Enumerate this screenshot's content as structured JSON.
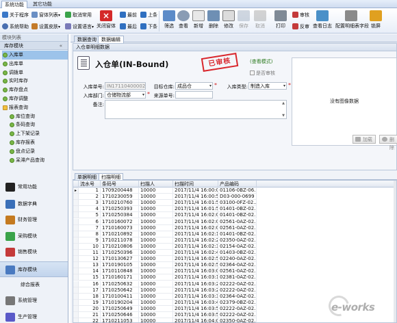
{
  "top_tabs": [
    "系统功能",
    "其它功能"
  ],
  "ribbon": {
    "small": [
      {
        "label": "关于程序",
        "icon": "info-icon"
      },
      {
        "label": "窗体列表",
        "icon": "window-list-icon"
      },
      {
        "label": "取消常用",
        "icon": "flag-icon"
      },
      {
        "label": "系统帮助",
        "icon": "help-icon"
      },
      {
        "label": "设置皮肤",
        "icon": "skin-icon"
      },
      {
        "label": "设置语言",
        "icon": "language-icon"
      }
    ],
    "close_window": "关闭窗体",
    "nav": [
      {
        "label": "最前",
        "icon": "first-icon"
      },
      {
        "label": "上条",
        "icon": "prev-icon"
      },
      {
        "label": "最后",
        "icon": "last-icon"
      },
      {
        "label": "下条",
        "icon": "next-icon"
      }
    ],
    "big": [
      {
        "label": "筛选",
        "icon": "filter-icon",
        "disabled": false
      },
      {
        "label": "查看",
        "icon": "view-icon",
        "disabled": false
      },
      {
        "label": "新增",
        "icon": "new-icon",
        "disabled": false
      },
      {
        "label": "删除",
        "icon": "delete-icon",
        "disabled": false
      },
      {
        "label": "修改",
        "icon": "edit-icon",
        "disabled": false
      },
      {
        "label": "保存",
        "icon": "save-icon",
        "disabled": true
      },
      {
        "label": "取消",
        "icon": "undo-icon",
        "disabled": true
      },
      {
        "label": "打印",
        "icon": "print-icon",
        "disabled": false
      }
    ],
    "approve": "审核",
    "unapprove": "反审",
    "audit_log": "查看日志",
    "config_detail": "配置明细表字段",
    "lock": "锁屏"
  },
  "sidebar": {
    "title": "模块列表",
    "group": "库存模块",
    "collapse": "«",
    "tree": [
      {
        "label": "入库单",
        "level": 0,
        "kind": "leaf",
        "selected": true
      },
      {
        "label": "出库单",
        "level": 0,
        "kind": "leaf",
        "selected": false
      },
      {
        "label": "调拨单",
        "level": 0,
        "kind": "leaf",
        "selected": false
      },
      {
        "label": "实时库存",
        "level": 0,
        "kind": "leaf",
        "selected": false
      },
      {
        "label": "库存盘点",
        "level": 0,
        "kind": "leaf",
        "selected": false
      },
      {
        "label": "库存调整",
        "level": 0,
        "kind": "leaf",
        "selected": false
      },
      {
        "label": "报表查询",
        "level": 0,
        "kind": "folder",
        "selected": false
      },
      {
        "label": "库位查询",
        "level": 1,
        "kind": "leaf",
        "selected": false
      },
      {
        "label": "条码查询",
        "level": 1,
        "kind": "leaf",
        "selected": false
      },
      {
        "label": "上下架记录",
        "level": 1,
        "kind": "leaf",
        "selected": false
      },
      {
        "label": "库存报表",
        "level": 1,
        "kind": "leaf",
        "selected": false
      },
      {
        "label": "盘点记录",
        "level": 1,
        "kind": "leaf",
        "selected": false
      },
      {
        "label": "呆滞产品查询",
        "level": 1,
        "kind": "leaf",
        "selected": false
      }
    ],
    "nav": [
      {
        "label": "常用功能",
        "icon": "cursor-icon"
      },
      {
        "label": "数据字典",
        "icon": "dictionary-icon"
      },
      {
        "label": "财务管理",
        "icon": "finance-icon"
      },
      {
        "label": "采购模块",
        "icon": "cart-icon"
      },
      {
        "label": "销售模块",
        "icon": "sales-icon"
      },
      {
        "label": "库存模块",
        "icon": "warehouse-icon",
        "active": true
      },
      {
        "label": "综合报表",
        "icon": "",
        "plain": true
      },
      {
        "label": "系统管理",
        "icon": "tools-icon"
      },
      {
        "label": "生产管理",
        "icon": "production-icon"
      }
    ]
  },
  "doc_tabs": [
    {
      "label": "数据查询",
      "active": false
    },
    {
      "label": "数据编辑",
      "active": true
    }
  ],
  "form": {
    "panel_title": "入仓单明细数据",
    "title": "入仓单(IN-Bound)",
    "stamp": "已审核",
    "mode": "(查看模式)",
    "approved_checkbox": "是否审核",
    "image_placeholder": "没有图像数据",
    "load_button": "加载",
    "delete_button": "删除",
    "fields": {
      "doc_no": {
        "label": "入库单号:",
        "value": "IN17110400002"
      },
      "target_wh": {
        "label": "目标仓库:",
        "value": "成品仓"
      },
      "in_type": {
        "label": "入库类型:",
        "value": "制造入库"
      },
      "dept": {
        "label": "入库部门:",
        "value": "仓储物流部"
      },
      "source_no": {
        "label": "来源单号:",
        "value": ""
      },
      "remark": {
        "label": "备注:",
        "value": ""
      }
    }
  },
  "detail": {
    "tabs": [
      {
        "label": "单据明细",
        "active": false
      },
      {
        "label": "扫描明细",
        "active": true
      }
    ],
    "columns": [
      "流水号",
      "条码号",
      "扫描人",
      "扫描时间",
      "产品编码"
    ],
    "rows": [
      [
        "1",
        "1709200448",
        "10000",
        "2017/11/4 16:00:03",
        "01106-0BZ-06..."
      ],
      [
        "2",
        "1710230059",
        "10000",
        "2017/11/4 16:00:51",
        "D03-000-0699"
      ],
      [
        "3",
        "1710210760",
        "10000",
        "2017/11/4 16:01:51",
        "03100-0FZ-02..."
      ],
      [
        "4",
        "1710250393",
        "10000",
        "2017/11/4 16:01:58",
        "01401-0BZ-02..."
      ],
      [
        "5",
        "1710250384",
        "10000",
        "2017/11/4 16:02:03",
        "01401-0BZ-02..."
      ],
      [
        "6",
        "1710160072",
        "10000",
        "2017/11/4 16:02:09",
        "02561-0AZ-02..."
      ],
      [
        "7",
        "1710160073",
        "10000",
        "2017/11/4 16:02:09",
        "02561-0AZ-02..."
      ],
      [
        "8",
        "1710210892",
        "10000",
        "2017/11/4 16:02:15",
        "01401-0BZ-02..."
      ],
      [
        "9",
        "1710211078",
        "10000",
        "2017/11/4 16:02:25",
        "02350-0AZ-02..."
      ],
      [
        "10",
        "1710210806",
        "10000",
        "2017/11/4 16:02:31",
        "02154-0AZ-02..."
      ],
      [
        "11",
        "1710250396",
        "10000",
        "2017/11/4 16:02:42",
        "01403-0BZ-02..."
      ],
      [
        "12",
        "1710130627",
        "10000",
        "2017/11/4 16:02:51",
        "02240-0AZ-02..."
      ],
      [
        "13",
        "1710190105",
        "10000",
        "2017/11/4 16:02:57",
        "02364-0AZ-02..."
      ],
      [
        "14",
        "1710110848",
        "10000",
        "2017/11/4 16:03:06",
        "02561-0AZ-02..."
      ],
      [
        "15",
        "1710160171",
        "10000",
        "2017/11/4 16:03:14",
        "02381-0AZ-02..."
      ],
      [
        "16",
        "1710250632",
        "10000",
        "2017/11/4 16:03:24",
        "02222-0AZ-02..."
      ],
      [
        "17",
        "1710250642",
        "10000",
        "2017/11/4 16:03:24",
        "02222-0AZ-02..."
      ],
      [
        "18",
        "1710100411",
        "10000",
        "2017/11/4 16:03:36",
        "02364-0AZ-02..."
      ],
      [
        "19",
        "1710190204",
        "10000",
        "2017/11/4 16:03:48",
        "02379-0BZ-02..."
      ],
      [
        "20",
        "1710250649",
        "10000",
        "2017/11/4 16:03:51",
        "02222-0AZ-02..."
      ],
      [
        "21",
        "1710250646",
        "10000",
        "2017/11/4 16:03:58",
        "02222-0AZ-02..."
      ],
      [
        "22",
        "1710211053",
        "10000",
        "2017/11/4 16:04:06",
        "02350-0AZ-02..."
      ]
    ]
  },
  "watermark": "e-works",
  "colors": {
    "stamp": "#d9262c",
    "mode_text": "#2a7a1e",
    "selected": "#9cc3ea",
    "required": "#d01818"
  }
}
